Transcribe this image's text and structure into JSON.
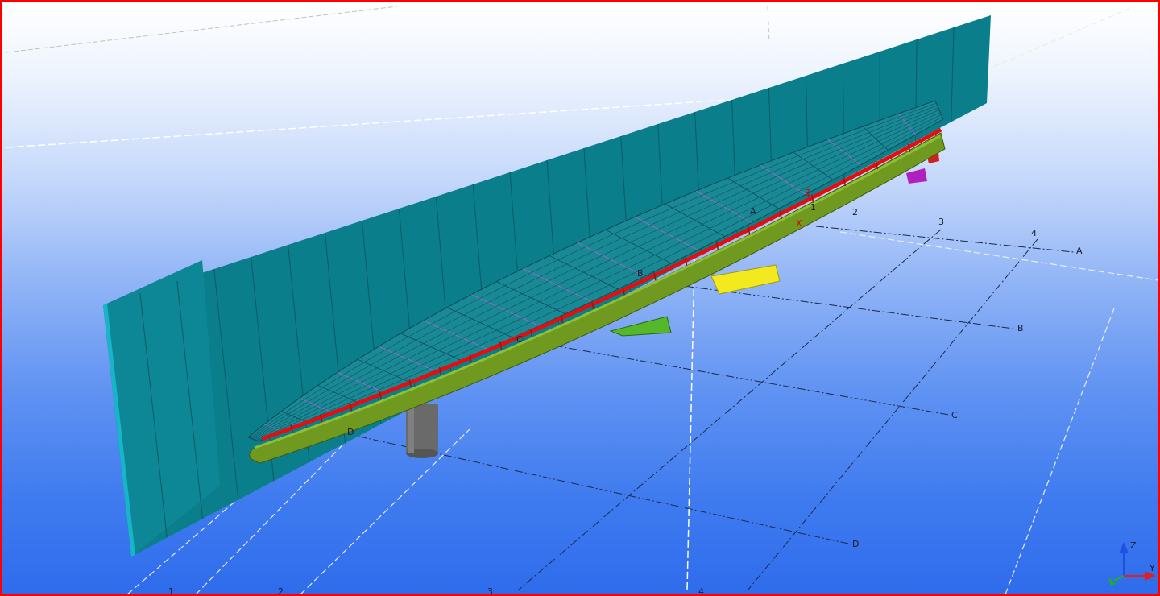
{
  "grid_labels": {
    "rows": [
      "A",
      "B",
      "C",
      "D"
    ],
    "columns": [
      "1",
      "2",
      "3",
      "4"
    ]
  },
  "axis_indicator": {
    "z": "Z",
    "y": "Y",
    "x": "X"
  },
  "colors": {
    "frame": "#ff0000",
    "wall": "#0a7f8d",
    "deck": "#1c8b97",
    "beam": "#6f9a1f",
    "edge_beam": "#e01010",
    "column": "#6a6a6a",
    "bracket_yellow": "#f2ea1e",
    "bracket_green": "#54b82a",
    "bracket_magenta": "#b020c0"
  }
}
